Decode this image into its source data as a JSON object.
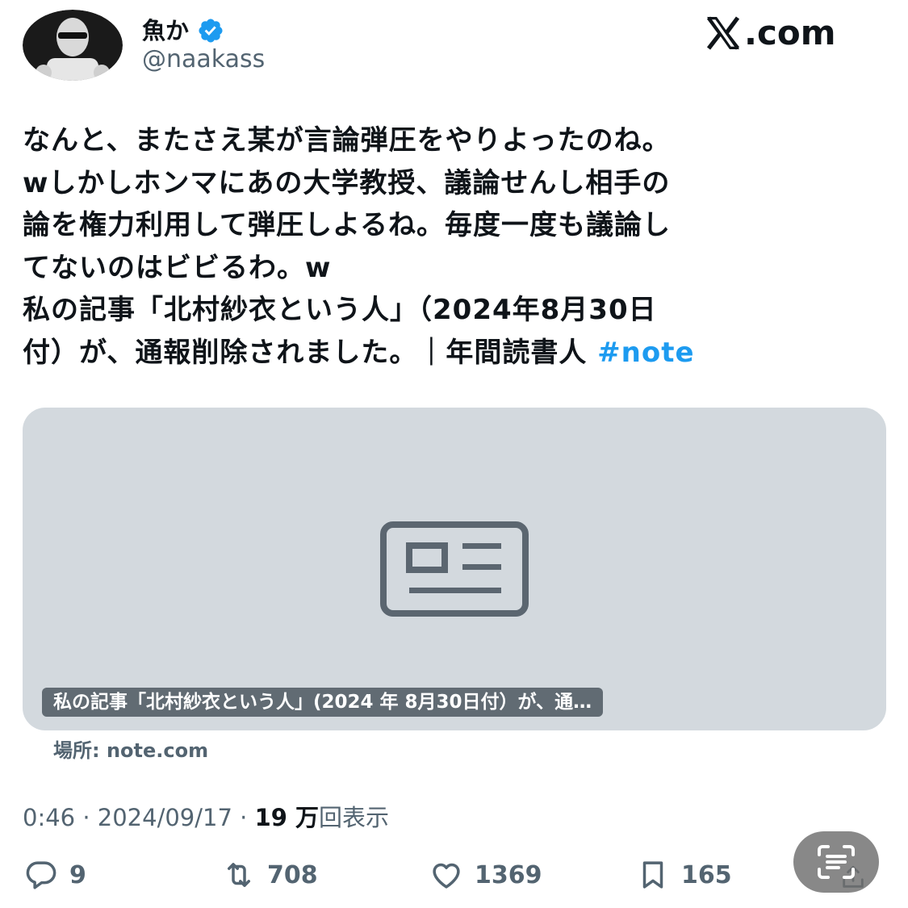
{
  "header": {
    "display_name": "魚か",
    "handle": "@naakass",
    "brand": ".com",
    "avatar_icon": "avatar-image",
    "verified_icon": "verified-badge-icon",
    "brand_icon": "x-logo-icon"
  },
  "tweet": {
    "lines": [
      "なんと、またさえ某が言論弾圧をやりよったのね。",
      "wしかしホンマにあの大学教授、議論せんし相手の",
      "論を権力利用して弾圧しよるね。毎度一度も議論し",
      "てないのはビビるわ。w",
      "私の記事「北村紗衣という人」（2024年8月30日"
    ],
    "last_line": "付）が、通報削除されました。｜年間読書人",
    "hashtag": "#note"
  },
  "card": {
    "caption": "私の記事「北村紗衣という人」(2024 年 8月30日付）が、通…",
    "source": "場所: note.com",
    "placeholder_icon": "article-icon"
  },
  "meta": {
    "time": "0:46",
    "date": "2024/09/17",
    "views_number": "19 万",
    "views_label": "回表示"
  },
  "actions": {
    "replies": "9",
    "retweets": "708",
    "likes": "1369",
    "bookmarks": "165"
  },
  "colors": {
    "accent": "#1d9bf0",
    "text": "#0f1419",
    "secondary": "#536471",
    "card_bg": "#d3d9de"
  }
}
